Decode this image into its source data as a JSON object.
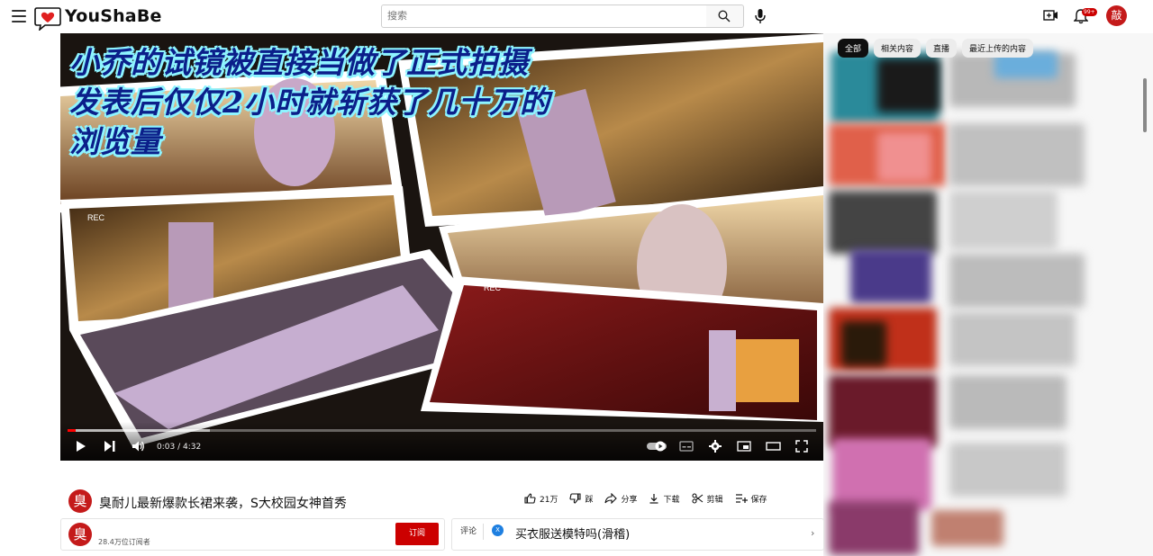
{
  "app": {
    "name": "YouShaBe"
  },
  "header": {
    "search_placeholder": "搜索",
    "notification_count": "99+",
    "user_avatar_char": "敲"
  },
  "player": {
    "overlay_text": "小乔的试镜被直接当做了正式拍摄\n发表后仅仅2小时就斩获了几十万的\n浏览量",
    "current_time": "0:03",
    "duration": "4:32",
    "time_display": "0:03 / 4:32",
    "progress_fraction": 0.011,
    "rec_label": "REC"
  },
  "sidebar": {
    "chips": [
      "全部",
      "相关内容",
      "直播",
      "最近上传的内容"
    ],
    "active_chip": "全部"
  },
  "video": {
    "title": "臭耐儿最新爆款长裙来袭，S大校园女神首秀",
    "channel_avatar_char": "臭",
    "subscribers": "28.4万位订阅者",
    "subscribe_label": "订阅"
  },
  "actions": {
    "like_count": "21万",
    "dislike_label": "踩",
    "share_label": "分享",
    "download_label": "下载",
    "clip_label": "剪辑",
    "save_label": "保存"
  },
  "comments": {
    "label": "评论",
    "avatar_char": "X",
    "top_comment": "买衣服送模特吗(滑稽)"
  },
  "colors": {
    "accent": "#cc0000",
    "progress": "#ff0000",
    "overlay_text": "#0b1f8a",
    "overlay_outline": "#8ef4ff"
  }
}
